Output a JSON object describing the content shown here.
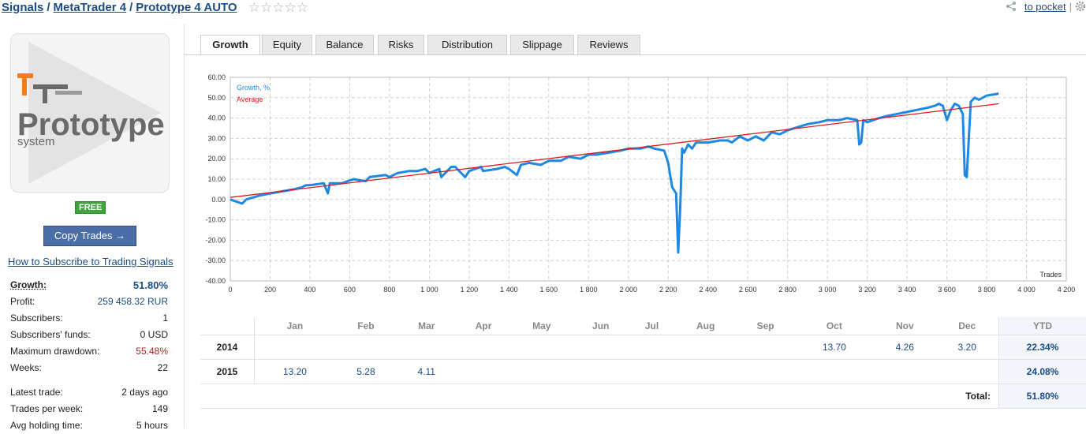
{
  "breadcrumb": {
    "items": [
      "Signals",
      "MetaTrader 4",
      "Prototype 4 AUTO"
    ],
    "separator": "/",
    "rating_stars": "☆☆☆☆☆"
  },
  "pocket": {
    "label": "to pocket"
  },
  "logo": {
    "line1": "Prototype",
    "line2": "system",
    "accent_color": "#f07d1e"
  },
  "badge": {
    "label": "FREE"
  },
  "copy_button": {
    "label": "Copy Trades →"
  },
  "howto_link": "How to Subscribe to Trading Signals",
  "stats": [
    {
      "key": "Growth:",
      "value": "51.80%"
    },
    {
      "key": "Profit:",
      "value": "259 458.32 RUR"
    },
    {
      "key": "Subscribers:",
      "value": "1"
    },
    {
      "key": "Subscribers' funds:",
      "value": "0 USD"
    },
    {
      "key": "Maximum drawdown:",
      "value": "55.48%"
    },
    {
      "key": "Weeks:",
      "value": "22"
    },
    {
      "key": "Latest trade:",
      "value": "2 days ago"
    },
    {
      "key": "Trades per week:",
      "value": "149"
    },
    {
      "key": "Avg holding time:",
      "value": "5 hours"
    }
  ],
  "tabs": [
    "Growth",
    "Equity",
    "Balance",
    "Risks",
    "Distribution",
    "Slippage",
    "Reviews"
  ],
  "active_tab": "Growth",
  "colors": {
    "growth_line": "#1e88e5",
    "average_line": "#d81e1e",
    "link": "#1a4c86",
    "drawdown": "#b22222",
    "growth_value": "#1a4c86"
  },
  "chart_data": {
    "type": "line",
    "xlabel": "Trades",
    "ylabel": "",
    "xlim": [
      0,
      4200
    ],
    "ylim": [
      -40,
      60
    ],
    "x_ticks": [
      "0",
      "200",
      "400",
      "600",
      "800",
      "1 000",
      "1 200",
      "1 400",
      "1 600",
      "1 800",
      "2 000",
      "2 200",
      "2 400",
      "2 600",
      "2 800",
      "3 000",
      "3 200",
      "3 400",
      "3 600",
      "3 800",
      "4 000",
      "4 200"
    ],
    "y_ticks": [
      "60.00",
      "50.00",
      "40.00",
      "30.00",
      "20.00",
      "10.00",
      "0.00",
      "-10.00",
      "-20.00",
      "-30.00",
      "-40.00"
    ],
    "legend": [
      "Growth, %",
      "Average"
    ],
    "legend_position": "top-left",
    "grid": true,
    "series": [
      {
        "name": "Growth, %",
        "x": [
          0,
          60,
          80,
          150,
          200,
          260,
          320,
          360,
          380,
          400,
          470,
          490,
          500,
          560,
          620,
          680,
          700,
          780,
          800,
          840,
          900,
          940,
          980,
          1000,
          1050,
          1060,
          1110,
          1130,
          1180,
          1200,
          1260,
          1270,
          1340,
          1380,
          1400,
          1440,
          1460,
          1500,
          1560,
          1600,
          1660,
          1700,
          1760,
          1800,
          1840,
          1900,
          1960,
          2000,
          2060,
          2100,
          2130,
          2180,
          2200,
          2220,
          2240,
          2250,
          2260,
          2270,
          2280,
          2300,
          2320,
          2340,
          2360,
          2400,
          2460,
          2500,
          2520,
          2560,
          2600,
          2640,
          2680,
          2720,
          2760,
          2800,
          2900,
          2960,
          3000,
          3060,
          3100,
          3150,
          3160,
          3170,
          3180,
          3200,
          3260,
          3300,
          3400,
          3500,
          3540,
          3560,
          3580,
          3600,
          3620,
          3640,
          3660,
          3680,
          3690,
          3700,
          3720,
          3740,
          3760,
          3800,
          3860
        ],
        "y": [
          0,
          -2,
          0,
          2,
          3,
          4,
          5,
          6,
          7,
          7,
          8,
          3,
          8,
          8,
          10,
          9,
          11,
          12,
          11,
          13,
          14,
          14,
          15,
          13,
          15,
          11,
          16,
          16,
          11,
          14,
          16,
          14,
          15,
          16,
          15,
          12,
          17,
          18,
          17,
          19,
          19,
          21,
          20,
          22,
          22,
          23,
          24,
          25,
          25,
          26,
          25,
          24,
          18,
          6,
          3,
          -26,
          -5,
          25,
          23,
          27,
          25,
          28,
          28,
          28,
          29,
          29,
          28,
          31,
          29,
          31,
          29,
          33,
          32,
          34,
          37,
          38,
          39,
          39,
          40,
          39,
          27,
          28,
          39,
          38,
          40,
          41,
          43,
          45,
          46,
          47,
          46,
          39,
          44,
          47,
          46,
          42,
          12,
          11,
          48,
          50,
          49,
          51,
          52
        ]
      },
      {
        "name": "Average",
        "x": [
          0,
          3860
        ],
        "y": [
          1.0,
          47.0
        ]
      }
    ]
  },
  "table": {
    "months": [
      "Jan",
      "Feb",
      "Mar",
      "Apr",
      "May",
      "Jun",
      "Jul",
      "Aug",
      "Sep",
      "Oct",
      "Nov",
      "Dec"
    ],
    "ytd_label": "YTD",
    "rows": [
      {
        "year": "2014",
        "values": [
          "",
          "",
          "",
          "",
          "",
          "",
          "",
          "",
          "",
          "13.70",
          "4.26",
          "3.20"
        ],
        "ytd": "22.34%"
      },
      {
        "year": "2015",
        "values": [
          "13.20",
          "5.28",
          "4.11",
          "",
          "",
          "",
          "",
          "",
          "",
          "",
          "",
          ""
        ],
        "ytd": "24.08%"
      }
    ],
    "total_label": "Total:",
    "total_value": "51.80%"
  }
}
